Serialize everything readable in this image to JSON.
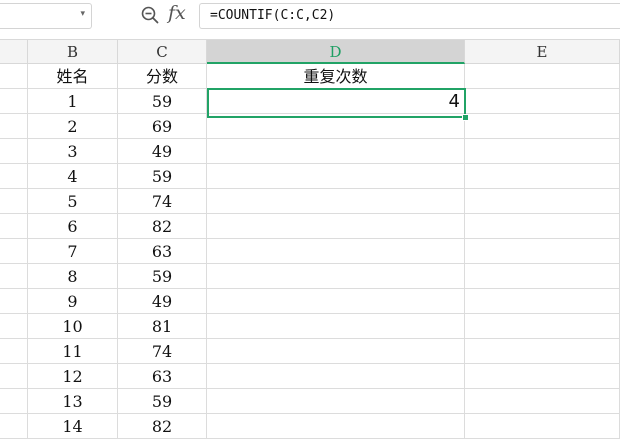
{
  "formula_bar": {
    "name_box_value": "",
    "fx_label": "fx",
    "formula": "=COUNTIF(C:C,C2)"
  },
  "columns": [
    "",
    "B",
    "C",
    "D",
    "E"
  ],
  "active_column": "D",
  "rows": [
    {
      "a": "",
      "b": "姓名",
      "c": "分数",
      "d": "重复次数",
      "e": ""
    },
    {
      "a": "",
      "b": "1",
      "c": "59",
      "d": "4",
      "e": ""
    },
    {
      "a": "",
      "b": "2",
      "c": "69",
      "d": "",
      "e": ""
    },
    {
      "a": "",
      "b": "3",
      "c": "49",
      "d": "",
      "e": ""
    },
    {
      "a": "",
      "b": "4",
      "c": "59",
      "d": "",
      "e": ""
    },
    {
      "a": "",
      "b": "5",
      "c": "74",
      "d": "",
      "e": ""
    },
    {
      "a": "",
      "b": "6",
      "c": "82",
      "d": "",
      "e": ""
    },
    {
      "a": "",
      "b": "7",
      "c": "63",
      "d": "",
      "e": ""
    },
    {
      "a": "",
      "b": "8",
      "c": "59",
      "d": "",
      "e": ""
    },
    {
      "a": "",
      "b": "9",
      "c": "49",
      "d": "",
      "e": ""
    },
    {
      "a": "",
      "b": "10",
      "c": "81",
      "d": "",
      "e": ""
    },
    {
      "a": "",
      "b": "11",
      "c": "74",
      "d": "",
      "e": ""
    },
    {
      "a": "",
      "b": "12",
      "c": "63",
      "d": "",
      "e": ""
    },
    {
      "a": "",
      "b": "13",
      "c": "59",
      "d": "",
      "e": ""
    },
    {
      "a": "",
      "b": "14",
      "c": "82",
      "d": "",
      "e": ""
    }
  ],
  "colors": {
    "selection": "#21a366",
    "active_header_text": "#1e9f63",
    "gridline": "#dcdcdc",
    "header_bg": "#f4f4f4"
  }
}
